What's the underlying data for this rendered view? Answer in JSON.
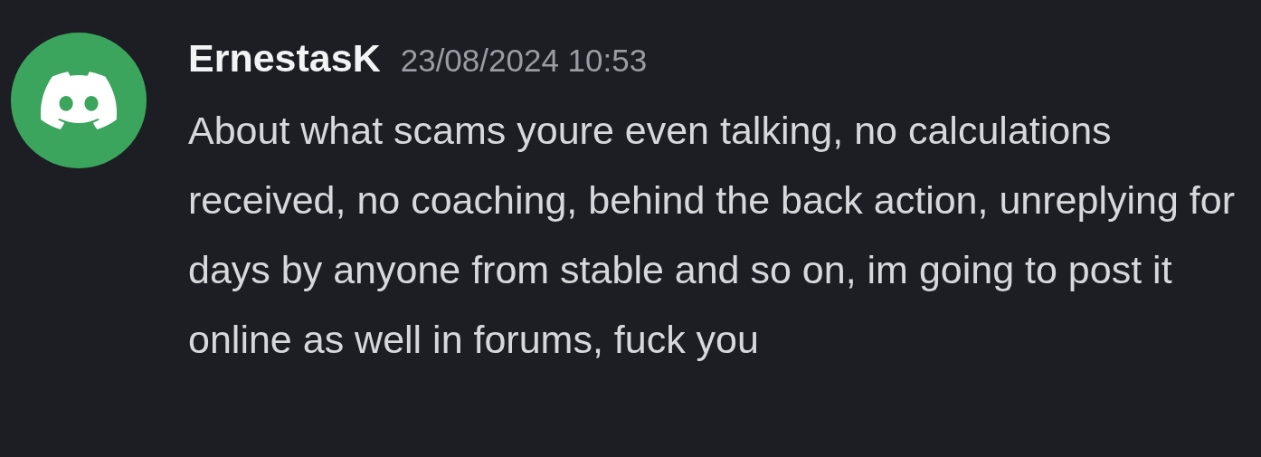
{
  "message": {
    "author": "ErnestasK",
    "timestamp": "23/08/2024 10:53",
    "text": "About what scams youre even talking, no calculations received, no coaching, behind the back action, unreplying for days by anyone from stable and so on, im going to post it online as well in forums, fuck you"
  }
}
